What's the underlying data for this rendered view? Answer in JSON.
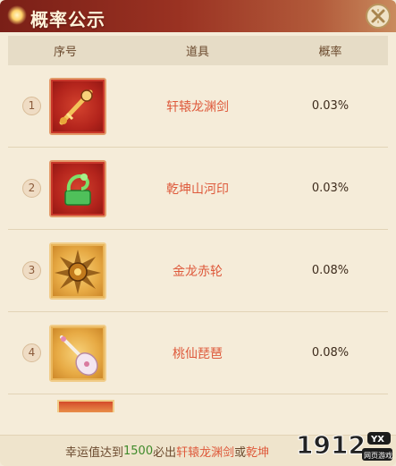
{
  "header": {
    "title": "概率公示"
  },
  "table": {
    "columns": [
      "序号",
      "道具",
      "概率"
    ],
    "rows": [
      {
        "rank": "1",
        "item": "轩辕龙渊剑",
        "probability": "0.03%",
        "icon": "sword-icon",
        "frame": "red"
      },
      {
        "rank": "2",
        "item": "乾坤山河印",
        "probability": "0.03%",
        "icon": "jade-seal-icon",
        "frame": "red"
      },
      {
        "rank": "3",
        "item": "金龙赤轮",
        "probability": "0.08%",
        "icon": "golden-wheel-icon",
        "frame": "gold"
      },
      {
        "rank": "4",
        "item": "桃仙琵琶",
        "probability": "0.08%",
        "icon": "pipa-icon",
        "frame": "gold"
      }
    ]
  },
  "footer": {
    "prefix": "幸运值达到",
    "number": "1500",
    "middle": "必出",
    "item1": "轩辕龙渊剑",
    "or": "或",
    "item2": "乾坤"
  },
  "watermark": {
    "brand": "1912",
    "badge": "YX",
    "sub": "网页游戏"
  },
  "colors": {
    "title_bar": "#8a2a1c",
    "item_name": "#de5a3c",
    "lucky_number": "#3f8a2a"
  }
}
